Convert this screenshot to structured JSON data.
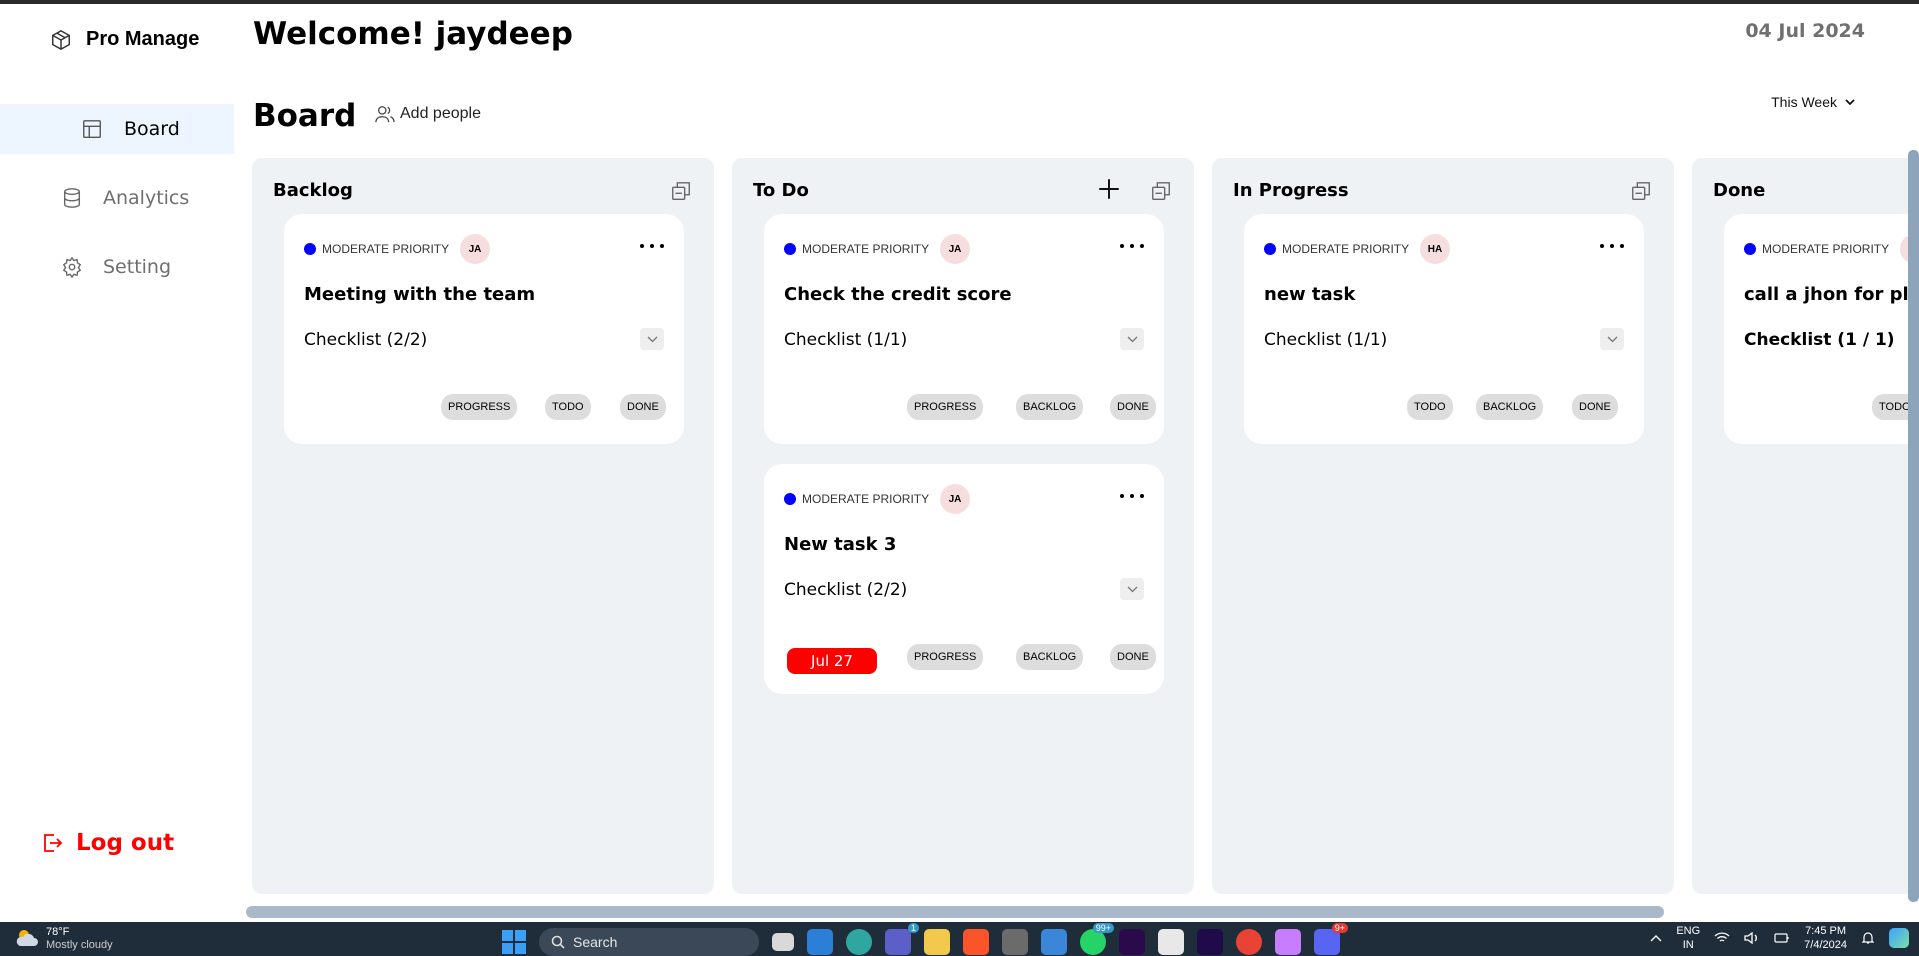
{
  "app": {
    "name": "Pro Manage"
  },
  "sidebar": {
    "items": [
      {
        "label": "Board",
        "icon": "layout-icon",
        "active": true
      },
      {
        "label": "Analytics",
        "icon": "database-icon",
        "active": false
      },
      {
        "label": "Setting",
        "icon": "gear-icon",
        "active": false
      }
    ],
    "logout_label": "Log out"
  },
  "header": {
    "welcome": "Welcome! jaydeep",
    "date": "04 Jul 2024",
    "page_title": "Board",
    "add_people_label": "Add people",
    "filter_value": "This Week"
  },
  "columns": [
    {
      "title": "Backlog",
      "cards": [
        {
          "priority": "MODERATE PRIORITY",
          "priority_color": "#0000ff",
          "avatar": "JA",
          "title": "Meeting with the team",
          "checklist": "Checklist (2/2)",
          "due": null,
          "actions": [
            "PROGRESS",
            "TODO",
            "DONE"
          ]
        }
      ]
    },
    {
      "title": "To Do",
      "cards": [
        {
          "priority": "MODERATE PRIORITY",
          "priority_color": "#0000ff",
          "avatar": "JA",
          "title": "Check the credit score",
          "checklist": "Checklist (1/1)",
          "due": null,
          "actions": [
            "PROGRESS",
            "BACKLOG",
            "DONE"
          ]
        },
        {
          "priority": "MODERATE PRIORITY",
          "priority_color": "#0000ff",
          "avatar": "JA",
          "title": "New task 3",
          "checklist": "Checklist (2/2)",
          "due": "Jul 27",
          "due_color": "#ff0000",
          "actions": [
            "PROGRESS",
            "BACKLOG",
            "DONE"
          ]
        }
      ]
    },
    {
      "title": "In Progress",
      "cards": [
        {
          "priority": "MODERATE PRIORITY",
          "priority_color": "#0000ff",
          "avatar": "HA",
          "title": "new task",
          "checklist": "Checklist (1/1)",
          "due": null,
          "actions": [
            "TODO",
            "BACKLOG",
            "DONE"
          ]
        }
      ]
    },
    {
      "title": "Done",
      "cards": [
        {
          "priority": "MODERATE PRIORITY",
          "priority_color": "#0000ff",
          "avatar": "",
          "title": "call a jhon for pla",
          "checklist": "Checklist (1 / 1)",
          "due": null,
          "actions": [
            "TODO"
          ]
        }
      ]
    }
  ],
  "taskbar": {
    "weather_temp": "78°F",
    "weather_condition": "Mostly cloudy",
    "search_label": "Search",
    "teams_badge": "1",
    "whatsapp_badge": "99+",
    "discord_badge": "9+",
    "lang_line1": "ENG",
    "lang_line2": "IN",
    "time": "7:45 PM",
    "date": "7/4/2024"
  },
  "colors": {
    "accent": "#edf5fe",
    "logout": "#ff0000",
    "column_bg": "#eef2f5",
    "taskbar": "#1f2d3a"
  }
}
